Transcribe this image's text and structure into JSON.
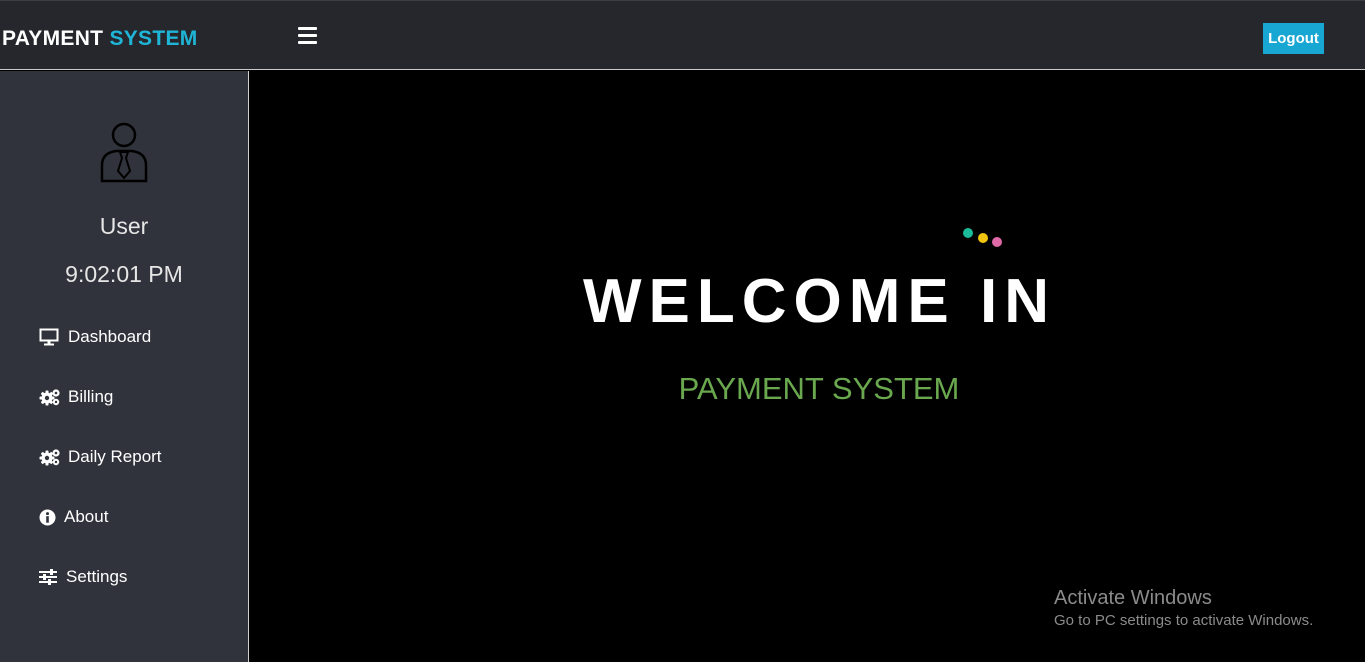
{
  "header": {
    "brand_part1": "PAYMENT",
    "brand_part2": "SYSTEM",
    "logout_label": "Logout",
    "accent_color": "#1fb5d6"
  },
  "sidebar": {
    "avatar_icon": "user-tie-icon",
    "username": "User",
    "clock": "9:02:01 PM",
    "items": [
      {
        "label": "Dashboard",
        "icon": "desktop-icon"
      },
      {
        "label": "Billing",
        "icon": "gears-icon"
      },
      {
        "label": "Daily Report",
        "icon": "gears-icon"
      },
      {
        "label": "About",
        "icon": "info-circle-icon"
      },
      {
        "label": "Settings",
        "icon": "sliders-icon"
      }
    ]
  },
  "main": {
    "welcome": "WELCOME IN",
    "subtitle": "PAYMENT SYSTEM",
    "subtitle_color": "#6aa84f",
    "dot_colors": [
      "#1abc9c",
      "#f1c40f",
      "#e06aa8"
    ]
  },
  "watermark": {
    "title": "Activate Windows",
    "subtitle": "Go to PC settings to activate Windows."
  }
}
